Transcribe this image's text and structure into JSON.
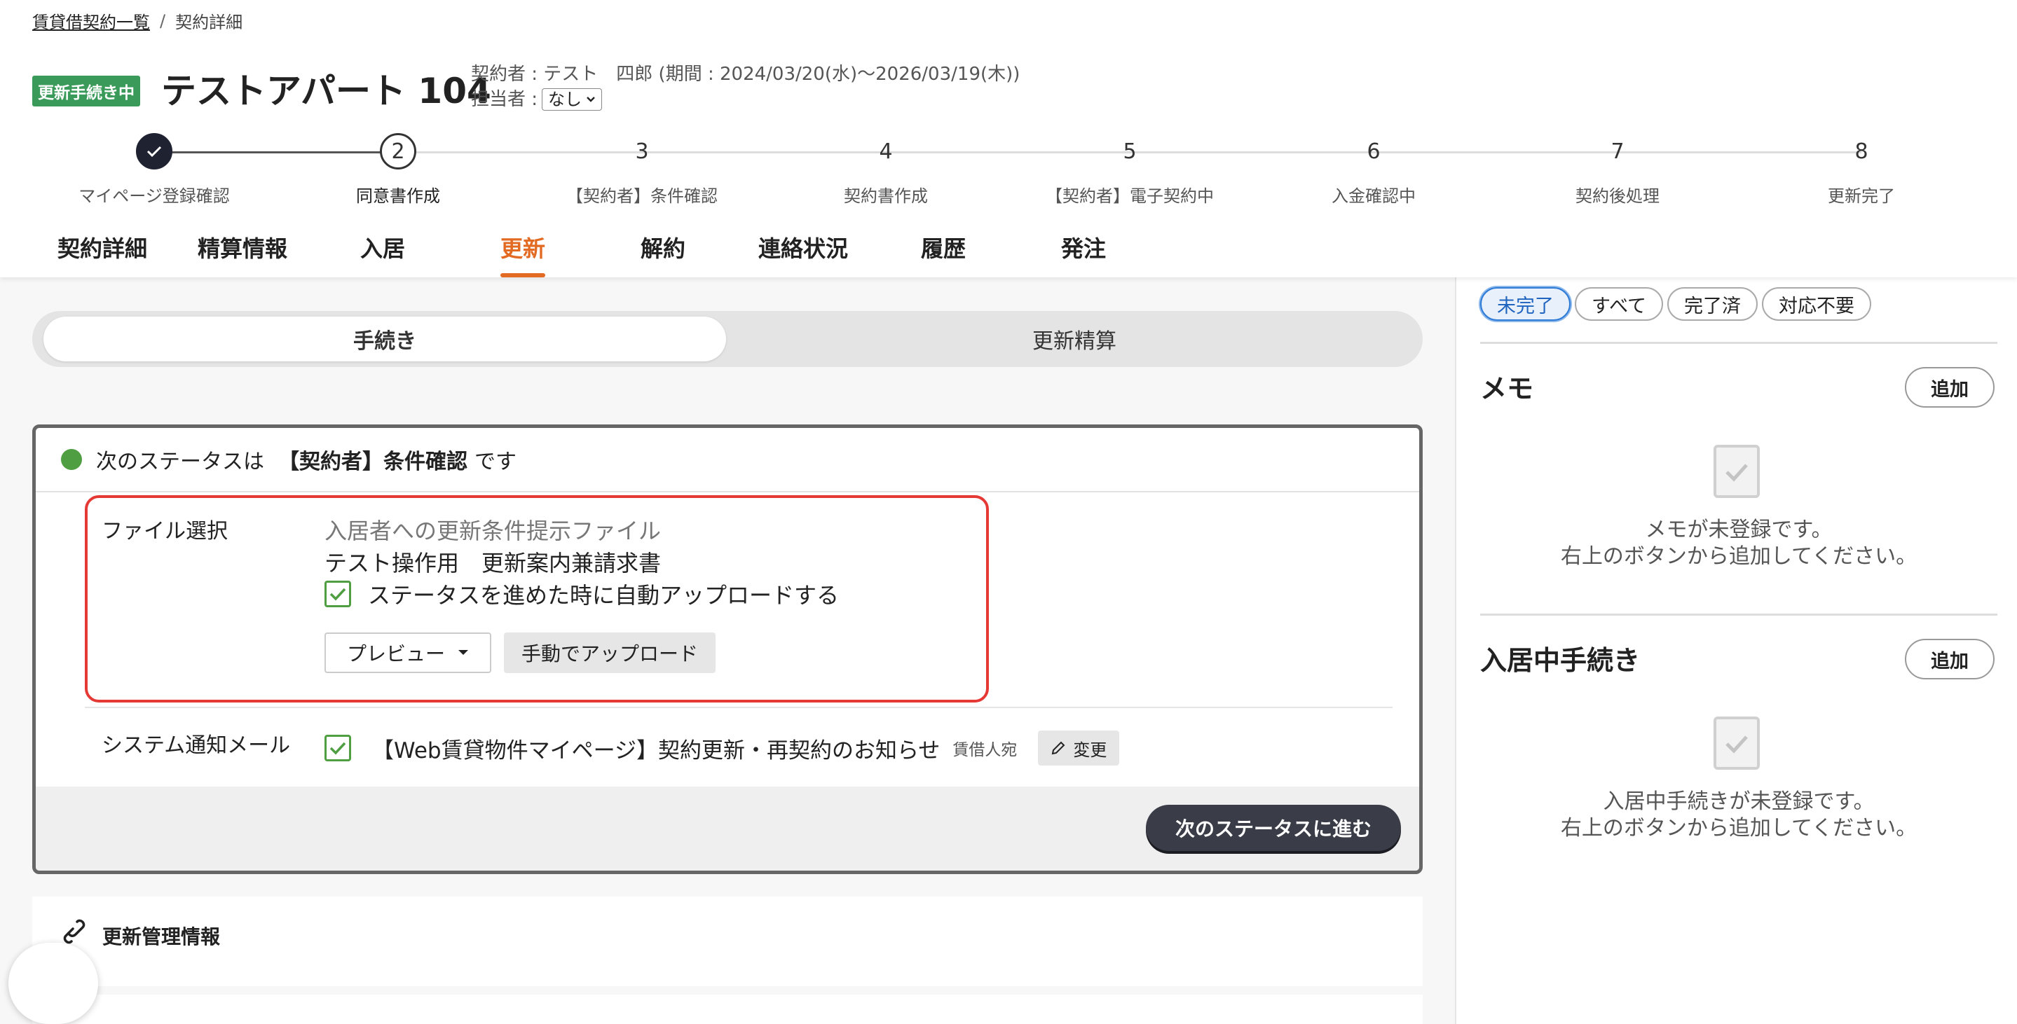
{
  "breadcrumb": {
    "link": "賃貸借契約一覧",
    "separator": "/",
    "current": "契約詳細"
  },
  "header": {
    "status_badge": "更新手続き中",
    "property_title": "テストアパート 104",
    "contract_info": "契約者 : テスト　四郎 (期間 : 2024/03/20(水)〜2026/03/19(木))",
    "assignee_label": "担当者 :",
    "assignee_value": "なし"
  },
  "stepper": {
    "steps": [
      {
        "number": "",
        "label": "マイページ登録確認",
        "state": "done"
      },
      {
        "number": "2",
        "label": "同意書作成",
        "state": "current"
      },
      {
        "number": "3",
        "label": "【契約者】条件確認",
        "state": "todo"
      },
      {
        "number": "4",
        "label": "契約書作成",
        "state": "todo"
      },
      {
        "number": "5",
        "label": "【契約者】電子契約中",
        "state": "todo"
      },
      {
        "number": "6",
        "label": "入金確認中",
        "state": "todo"
      },
      {
        "number": "7",
        "label": "契約後処理",
        "state": "todo"
      },
      {
        "number": "8",
        "label": "更新完了",
        "state": "todo"
      }
    ]
  },
  "tabs": [
    {
      "label": "契約詳細",
      "active": false
    },
    {
      "label": "精算情報",
      "active": false
    },
    {
      "label": "入居",
      "active": false
    },
    {
      "label": "更新",
      "active": true
    },
    {
      "label": "解約",
      "active": false
    },
    {
      "label": "連絡状況",
      "active": false
    },
    {
      "label": "履歴",
      "active": false
    },
    {
      "label": "発注",
      "active": false
    }
  ],
  "segmented": {
    "procedure": "手続き",
    "settlement": "更新精算",
    "active": "procedure"
  },
  "status_card": {
    "prefix": "次のステータスは",
    "next_status": "【契約者】条件確認",
    "suffix": "です",
    "file_section": {
      "label": "ファイル選択",
      "hint": "入居者への更新条件提示ファイル",
      "file_name": "テスト操作用　更新案内兼請求書",
      "auto_upload_label": "ステータスを進めた時に自動アップロードする",
      "auto_upload_checked": true,
      "preview_button": "プレビュー",
      "manual_upload_button": "手動でアップロード"
    },
    "mail_section": {
      "label": "システム通知メール",
      "checked": true,
      "mail_title": "【Web賃貸物件マイページ】契約更新・再契約のお知らせ",
      "recipient": "賃借人宛",
      "edit_button": "変更"
    },
    "next_button": "次のステータスに進む"
  },
  "info_section": {
    "title": "更新管理情報"
  },
  "right_panel": {
    "filters": [
      {
        "label": "未完了",
        "active": true
      },
      {
        "label": "すべて",
        "active": false
      },
      {
        "label": "完了済",
        "active": false
      },
      {
        "label": "対応不要",
        "active": false
      }
    ],
    "memo": {
      "title": "メモ",
      "add_button": "追加",
      "empty_line1": "メモが未登録です。",
      "empty_line2": "右上のボタンから追加してください。"
    },
    "procedures": {
      "title": "入居中手続き",
      "add_button": "追加",
      "empty_line1": "入居中手続きが未登録です。",
      "empty_line2": "右上のボタンから追加してください。"
    }
  },
  "colors": {
    "accent": "#e36a22",
    "success": "#4f9e41",
    "badge": "#3a9a5a",
    "danger_outline": "#e53935",
    "primary_dark": "#3a3d47"
  }
}
